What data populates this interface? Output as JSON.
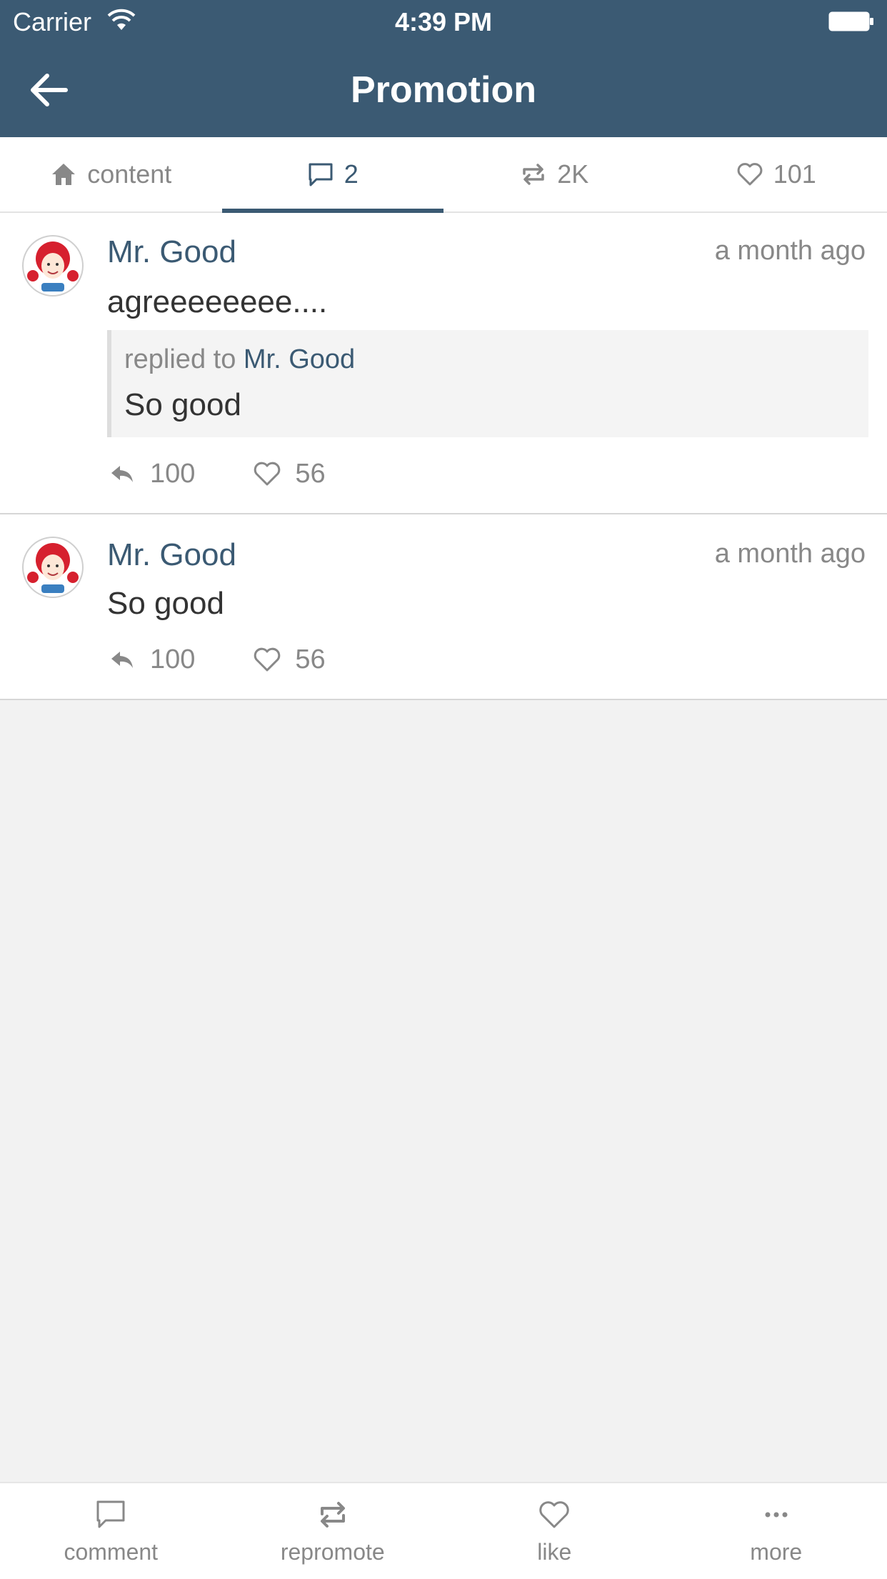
{
  "status_bar": {
    "carrier": "Carrier",
    "time": "4:39 PM"
  },
  "nav": {
    "title": "Promotion"
  },
  "tabs": [
    {
      "label": "content",
      "icon": "home-icon"
    },
    {
      "label": "2",
      "icon": "comment-icon",
      "active": true
    },
    {
      "label": "2K",
      "icon": "repost-icon"
    },
    {
      "label": "101",
      "icon": "heart-icon"
    }
  ],
  "comments": [
    {
      "name": "Mr. Good",
      "time": "a month ago",
      "text": "agreeeeeeee....",
      "reply": {
        "prefix": "replied to ",
        "to": "Mr. Good",
        "text": "So good"
      },
      "reply_count": "100",
      "like_count": "56"
    },
    {
      "name": "Mr. Good",
      "time": "a month ago",
      "text": "So good",
      "reply_count": "100",
      "like_count": "56"
    }
  ],
  "bottom_bar": {
    "comment": "comment",
    "repromote": "repromote",
    "like": "like",
    "more": "more"
  },
  "colors": {
    "accent": "#3b5a73",
    "muted": "#888888",
    "background": "#f2f2f2"
  }
}
